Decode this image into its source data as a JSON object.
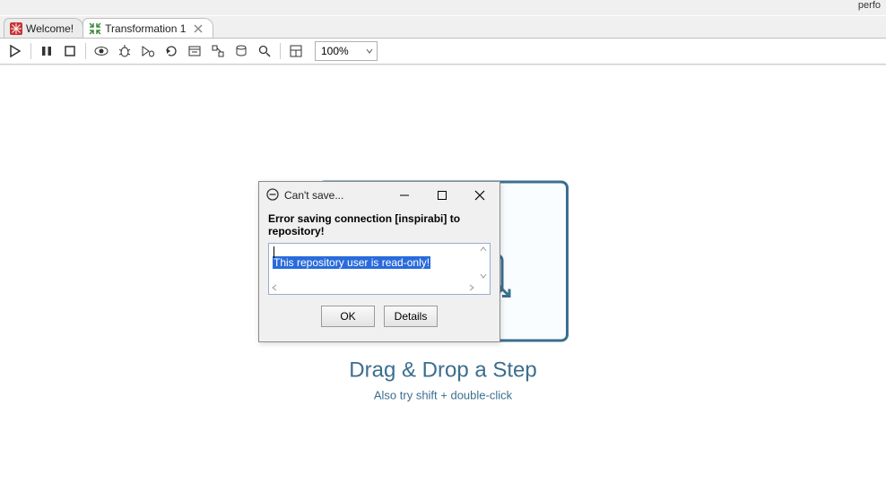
{
  "top_strip": {
    "perf_label": "perfo"
  },
  "tabs": [
    {
      "label": "Welcome!",
      "icon": "snowflake"
    },
    {
      "label": "Transformation 1",
      "icon": "arrows-in",
      "active": true
    }
  ],
  "toolbar": {
    "buttons": [
      "run",
      "pause",
      "stop",
      "preview",
      "debug",
      "debug-run",
      "sql",
      "analyze-impact",
      "analyze-db",
      "db-explorer",
      "show-results",
      "grid",
      "align"
    ],
    "zoom": "100%"
  },
  "drop_hint": {
    "title": "Drag & Drop a Step",
    "subtitle": "Also try shift + double-click"
  },
  "dialog": {
    "title": "Can't save...",
    "error_heading": "Error saving connection [inspirabi] to repository!",
    "message": "This repository user is read-only!",
    "buttons": {
      "ok": "OK",
      "details": "Details"
    }
  }
}
